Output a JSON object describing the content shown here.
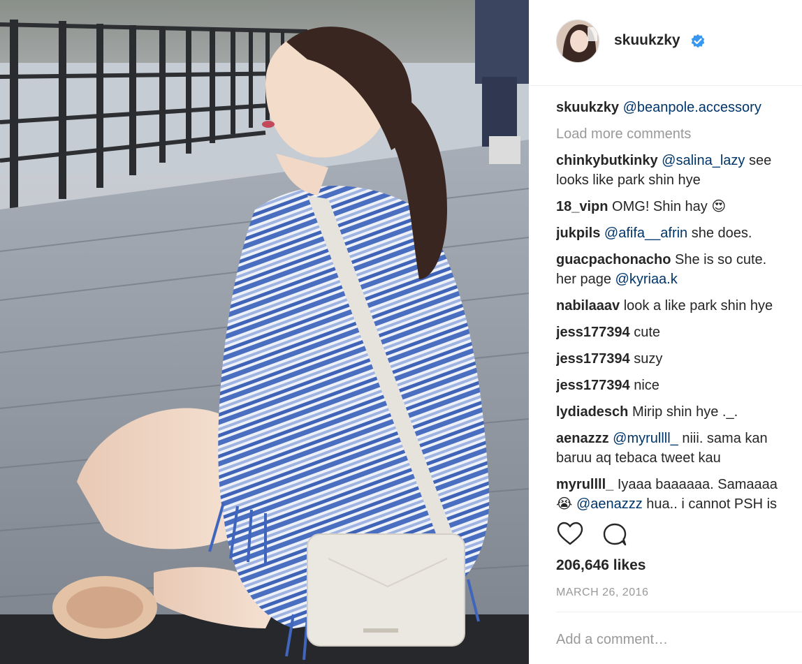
{
  "post": {
    "username": "skuukzky",
    "verified": true,
    "avatar_alt": "avatar",
    "photo_alt": "Post photo"
  },
  "caption": {
    "username": "skuukzky",
    "mention": "@beanpole.accessory"
  },
  "load_more": "Load more comments",
  "comments": [
    {
      "user": "chinkybutkinky",
      "mention": "@salina_lazy",
      "text": " see",
      "line2": "looks like park shin hye"
    },
    {
      "user": "18_vipn",
      "mention": "",
      "text": " OMG! Shin hay 😍",
      "line2": ""
    },
    {
      "user": "jukpils",
      "mention": "@afifa__afrin",
      "text": " she does.",
      "line2": ""
    },
    {
      "user": "guacpachonacho",
      "mention": "",
      "text": " She is so cute.",
      "line2": "her page",
      "line2_mention": "@kyriaa.k"
    },
    {
      "user": "nabilaaav",
      "mention": "",
      "text": " look a like park shin hye",
      "line2": ""
    },
    {
      "user": "jess177394",
      "mention": "",
      "text": " cute",
      "line2": ""
    },
    {
      "user": "jess177394",
      "mention": "",
      "text": " suzy",
      "line2": ""
    },
    {
      "user": "jess177394",
      "mention": "",
      "text": " nice",
      "line2": ""
    },
    {
      "user": "lydiadesch",
      "mention": "",
      "text": " Mirip shin hye ._.",
      "line2": ""
    },
    {
      "user": "aenazzz",
      "mention": "@myrullll_",
      "text": " niii. sama kan",
      "line2": "baruu aq tebaca tweet kau"
    },
    {
      "user": "myrullll_",
      "mention": "",
      "text": " Iyaaa baaaaaa. Samaaaa",
      "line2": "😭",
      "line2_mention": "@aenazzz",
      "line2_tail": " hua.. i cannot PSH is"
    }
  ],
  "actions": {
    "like_icon": "heart-icon",
    "comment_icon": "comment-bubble-icon"
  },
  "likes": "206,646 likes",
  "date": "MARCH 26, 2016",
  "add_comment": {
    "placeholder": "Add a comment…"
  },
  "colors": {
    "link": "#003569",
    "muted": "#999999",
    "verified": "#3897f0",
    "text": "#262626"
  }
}
